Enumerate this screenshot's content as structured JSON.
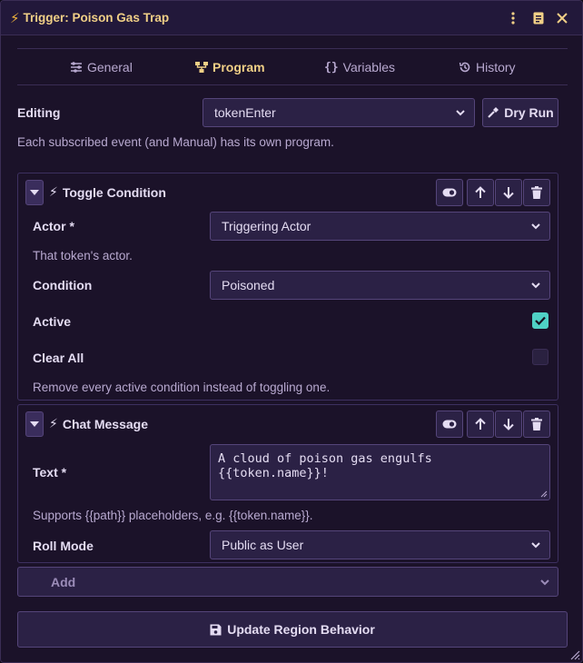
{
  "window": {
    "title": "Trigger: Poison Gas Trap"
  },
  "tabs": [
    {
      "label": "General",
      "icon": "sliders-icon"
    },
    {
      "label": "Program",
      "icon": "sitemap-icon",
      "active": true
    },
    {
      "label": "Variables",
      "icon": "braces-icon"
    },
    {
      "label": "History",
      "icon": "history-icon"
    }
  ],
  "editing": {
    "label": "Editing",
    "value": "tokenEnter",
    "dry_run_label": "Dry Run",
    "hint": "Each subscribed event (and Manual) has its own program."
  },
  "steps": [
    {
      "title": "Toggle Condition",
      "fields": {
        "actor_label": "Actor *",
        "actor_value": "Triggering Actor",
        "actor_hint": "That token's actor.",
        "condition_label": "Condition",
        "condition_value": "Poisoned",
        "active_label": "Active",
        "active_checked": true,
        "clear_all_label": "Clear All",
        "clear_all_checked": false,
        "clear_all_hint": "Remove every active condition instead of toggling one."
      }
    },
    {
      "title": "Chat Message",
      "fields": {
        "text_label": "Text *",
        "text_value": "A cloud of poison gas engulfs {{token.name}}!",
        "text_hint": "Supports {{path}} placeholders, e.g. {{token.name}}.",
        "roll_mode_label": "Roll Mode",
        "roll_mode_value": "Public as User"
      }
    }
  ],
  "add": {
    "label": "Add"
  },
  "footer": {
    "update_label": "Update Region Behavior"
  },
  "colors": {
    "accent": "#f0cf86",
    "check": "#4fd1c5",
    "background": "#1b1229"
  }
}
